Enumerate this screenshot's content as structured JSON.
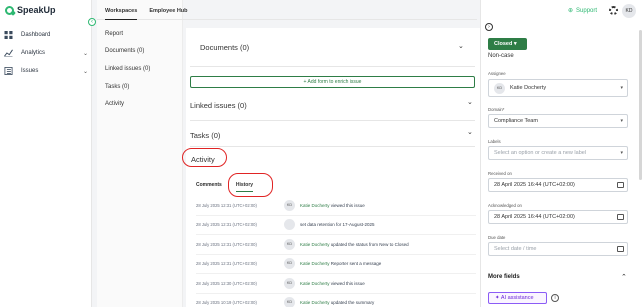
{
  "app": {
    "name": "SpeakUp"
  },
  "sidebar": {
    "items": [
      {
        "label": "Dashboard",
        "icon": "dashboard-icon"
      },
      {
        "label": "Analytics",
        "icon": "analytics-icon"
      },
      {
        "label": "Issues",
        "icon": "issues-icon"
      }
    ]
  },
  "top_tabs": [
    "Workspaces",
    "Employee Hub"
  ],
  "subnav": [
    "Report",
    "Documents (0)",
    "Linked issues (0)",
    "Tasks (0)",
    "Activity"
  ],
  "main": {
    "documents_title": "Documents (0)",
    "add_form_label": "+ Add form to enrich issue",
    "linked_title": "Linked issues (0)",
    "tasks_title": "Tasks (0)",
    "activity_title": "Activity",
    "activity_tabs": [
      "Comments",
      "History"
    ],
    "history": [
      {
        "time": "28 July 2025 12:31 (UTC+02:00)",
        "avatar": "KD",
        "user": "Katie Docherty",
        "text": "viewed this issue"
      },
      {
        "time": "28 July 2025 12:31 (UTC+02:00)",
        "avatar": "",
        "user": "",
        "text": "set data retention for 17-August-2025"
      },
      {
        "time": "28 July 2025 12:31 (UTC+02:00)",
        "avatar": "KD",
        "user": "Katie Docherty",
        "text": "updated the status from New to Closed"
      },
      {
        "time": "28 July 2025 12:31 (UTC+02:00)",
        "avatar": "KD",
        "user": "Katie Docherty",
        "text": "Reporter sent a message"
      },
      {
        "time": "28 July 2025 12:30 (UTC+02:00)",
        "avatar": "KD",
        "user": "Katie Docherty",
        "text": "viewed this issue"
      },
      {
        "time": "28 July 2025 10:19 (UTC+02:00)",
        "avatar": "KD",
        "user": "Katie Docherty",
        "text": "updated the summary"
      }
    ]
  },
  "header": {
    "support_label": "Support",
    "user_initials": "KD"
  },
  "panel": {
    "status": "Closed",
    "status_caption": "Non-case",
    "assignee_label": "Assignee",
    "assignee_initials": "KD",
    "assignee_name": "Katie Docherty",
    "domain_label": "Domain*",
    "domain_value": "Compliance Team",
    "labels_label": "Labels",
    "labels_placeholder": "Select an option or create a new label",
    "received_label": "Received on",
    "received_value": "28 April 2025 16:44 (UTC+02:00)",
    "ack_label": "Acknowledged on",
    "ack_value": "28 April 2025 16:44 (UTC+02:00)",
    "due_label": "Due date",
    "due_placeholder": "Select date / time",
    "more_fields": "More fields",
    "ai_label": "AI assistance"
  },
  "colors": {
    "brand": "#2eb872",
    "primary": "#2e7d46",
    "highlight": "#e02424",
    "ai": "#8b5cf6"
  }
}
